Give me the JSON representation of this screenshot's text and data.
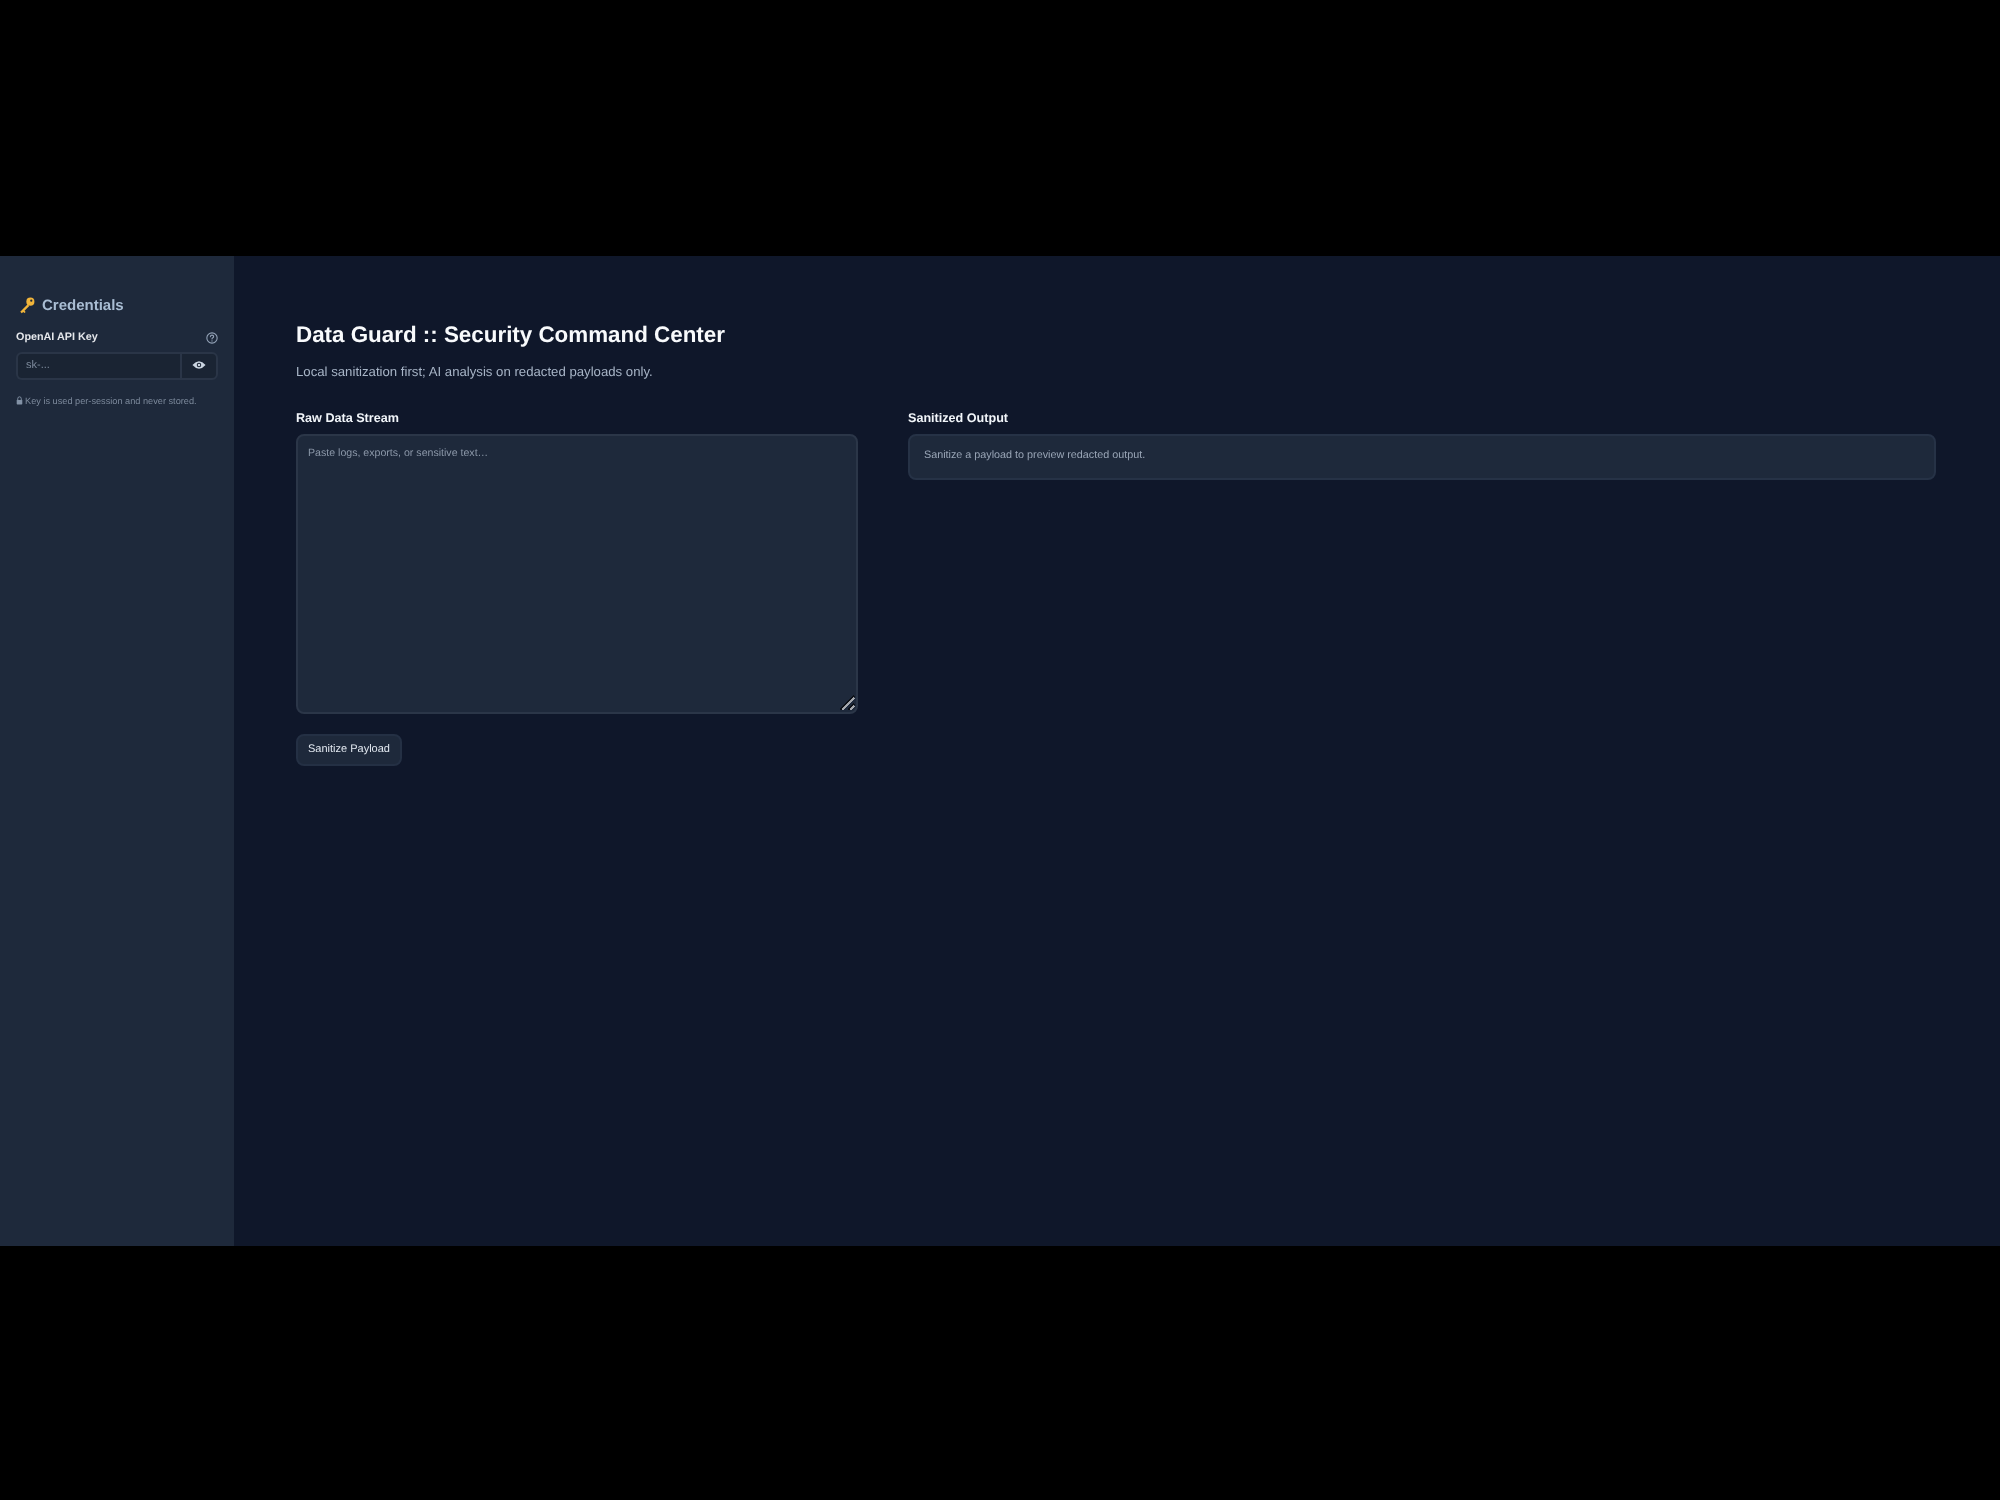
{
  "sidebar": {
    "title": "Credentials",
    "api_key_field": {
      "label": "OpenAI API Key",
      "placeholder": "sk-..."
    },
    "note": "Key is used per-session and never stored."
  },
  "header": {
    "title": "Data Guard :: Security Command Center",
    "subtitle": "Local sanitization first; AI analysis on redacted payloads only."
  },
  "input_panel": {
    "label": "Raw Data Stream",
    "placeholder": "Paste logs, exports, or sensitive text…",
    "button": "Sanitize Payload"
  },
  "output_panel": {
    "label": "Sanitized Output",
    "message": "Sanitize a payload to preview redacted output."
  }
}
